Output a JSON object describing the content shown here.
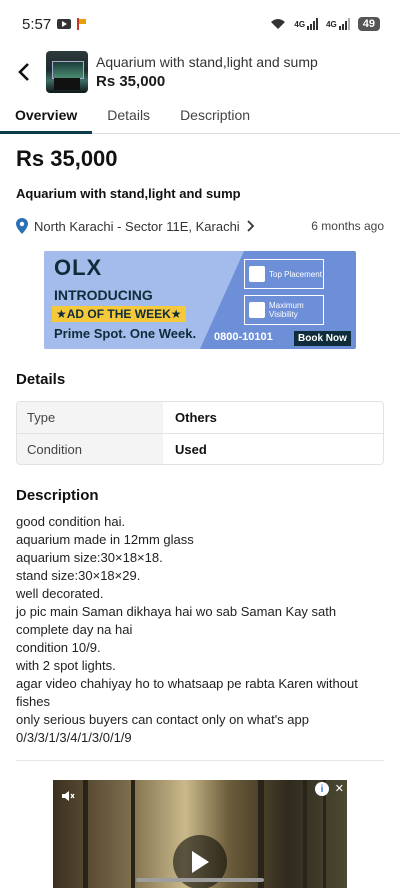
{
  "status": {
    "time": "5:57",
    "net1": "4G",
    "net2": "4G",
    "battery": "49"
  },
  "header": {
    "title": "Aquarium with stand,light and sump",
    "price": "Rs 35,000"
  },
  "tabs": [
    {
      "label": "Overview",
      "active": true
    },
    {
      "label": "Details",
      "active": false
    },
    {
      "label": "Description",
      "active": false
    }
  ],
  "listing": {
    "price": "Rs 35,000",
    "title": "Aquarium with stand,light and sump",
    "location": "North Karachi - Sector 11E, Karachi",
    "posted": "6 months ago"
  },
  "banner": {
    "brand": "OLX",
    "line1": "INTRODUCING",
    "line2": "★AD OF THE WEEK★",
    "line3": "Prime Spot. One Week.",
    "box1": "Top Placement",
    "box2": "Maximum Visibility",
    "phone": "0800-10101",
    "cta": "Book Now"
  },
  "details": {
    "heading": "Details",
    "rows": [
      {
        "label": "Type",
        "value": "Others"
      },
      {
        "label": "Condition",
        "value": "Used"
      }
    ]
  },
  "description": {
    "heading": "Description",
    "lines": [
      "good condition hai.",
      "aquarium made in 12mm glass",
      "aquarium size:30×18×18.",
      "stand size:30×18×29.",
      "well decorated.",
      "jo pic main Saman dikhaya hai wo sab Saman Kay sath complete day na hai",
      "condition 10/9.",
      "with 2 spot lights.",
      "agar video chahiyay ho to whatsaap pe rabta Karen without fishes",
      "only serious buyers can contact only on what's app 0/3/3/1/3/4/1/3/0/1/9"
    ]
  },
  "colors": {
    "accent": "#0b3c4a",
    "banner_blue": "#6d8fd8",
    "banner_yellow": "#f6c93b"
  }
}
